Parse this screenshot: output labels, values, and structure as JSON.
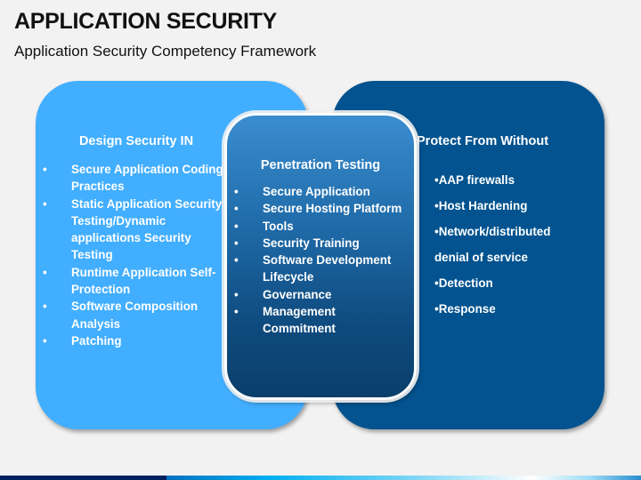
{
  "header": {
    "title": "APPLICATION SECURITY",
    "subtitle": "Application Security Competency Framework"
  },
  "panels": {
    "left": {
      "heading": "Design Security IN",
      "items": [
        "Secure Application Coding Practices",
        "Static Application Security Testing/Dynamic applications Security Testing",
        "Runtime Application Self-Protection",
        "Software Composition Analysis",
        "Patching"
      ],
      "color": "#42aeff"
    },
    "center": {
      "heading": "Penetration Testing",
      "items": [
        "Secure Application",
        "Secure Hosting Platform",
        "Tools",
        "Security Training",
        "Software Development Lifecycle",
        "Governance",
        "Management Commitment"
      ],
      "color_top": "#3a8dcf",
      "color_bottom": "#0a3f6c"
    },
    "right": {
      "heading": "Protect From Without",
      "items": [
        "•AAP firewalls",
        "•Host Hardening",
        "•Network/distributed",
        "denial of service",
        "•Detection",
        "•Response"
      ],
      "color": "#02538f"
    }
  },
  "bullet_glyph": "•"
}
